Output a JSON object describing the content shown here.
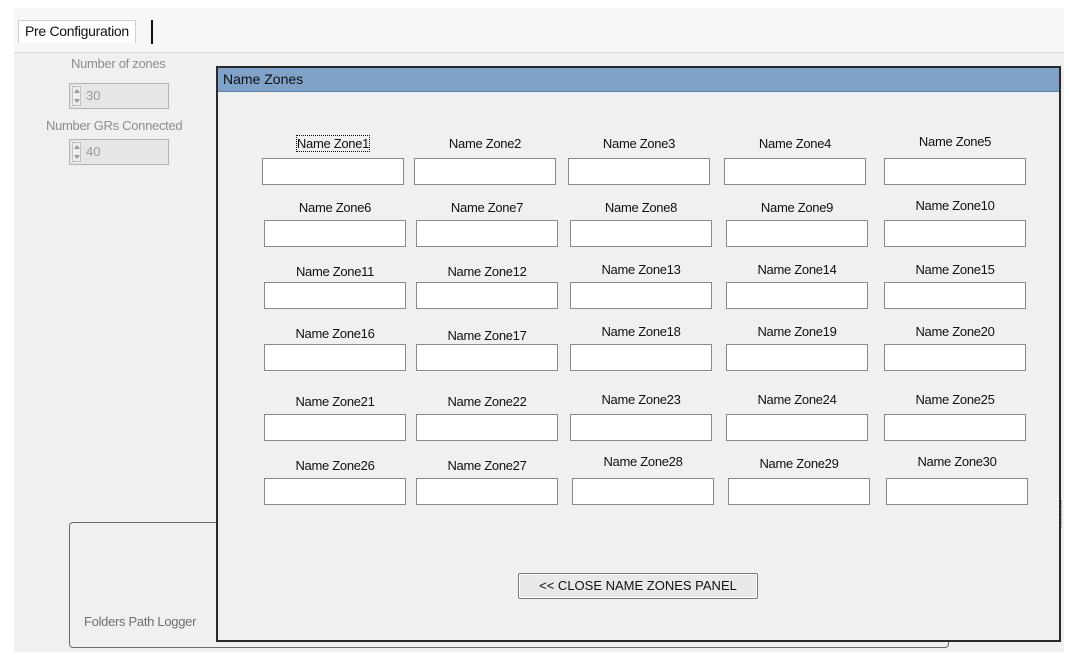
{
  "tab": {
    "label": "Pre Configuration"
  },
  "config": {
    "zones_label": "Number of zones",
    "zones_value": "30",
    "grs_label": "Number GRs Connected",
    "grs_value": "40",
    "folders_label": "Folders Path Logger"
  },
  "dialog": {
    "title": "Name Zones",
    "close_label": "<< CLOSE NAME ZONES PANEL",
    "zones": [
      {
        "label": "Name Zone1",
        "value": ""
      },
      {
        "label": "Name Zone2",
        "value": ""
      },
      {
        "label": "Name Zone3",
        "value": ""
      },
      {
        "label": "Name Zone4",
        "value": ""
      },
      {
        "label": "Name Zone5",
        "value": ""
      },
      {
        "label": "Name Zone6",
        "value": ""
      },
      {
        "label": "Name Zone7",
        "value": ""
      },
      {
        "label": "Name Zone8",
        "value": ""
      },
      {
        "label": "Name Zone9",
        "value": ""
      },
      {
        "label": "Name Zone10",
        "value": ""
      },
      {
        "label": "Name Zone11",
        "value": ""
      },
      {
        "label": "Name Zone12",
        "value": ""
      },
      {
        "label": "Name Zone13",
        "value": ""
      },
      {
        "label": "Name Zone14",
        "value": ""
      },
      {
        "label": "Name Zone15",
        "value": ""
      },
      {
        "label": "Name Zone16",
        "value": ""
      },
      {
        "label": "Name Zone17",
        "value": ""
      },
      {
        "label": "Name Zone18",
        "value": ""
      },
      {
        "label": "Name Zone19",
        "value": ""
      },
      {
        "label": "Name Zone20",
        "value": ""
      },
      {
        "label": "Name Zone21",
        "value": ""
      },
      {
        "label": "Name Zone22",
        "value": ""
      },
      {
        "label": "Name Zone23",
        "value": ""
      },
      {
        "label": "Name Zone24",
        "value": ""
      },
      {
        "label": "Name Zone25",
        "value": ""
      },
      {
        "label": "Name Zone26",
        "value": ""
      },
      {
        "label": "Name Zone27",
        "value": ""
      },
      {
        "label": "Name Zone28",
        "value": ""
      },
      {
        "label": "Name Zone29",
        "value": ""
      },
      {
        "label": "Name Zone30",
        "value": ""
      }
    ]
  }
}
